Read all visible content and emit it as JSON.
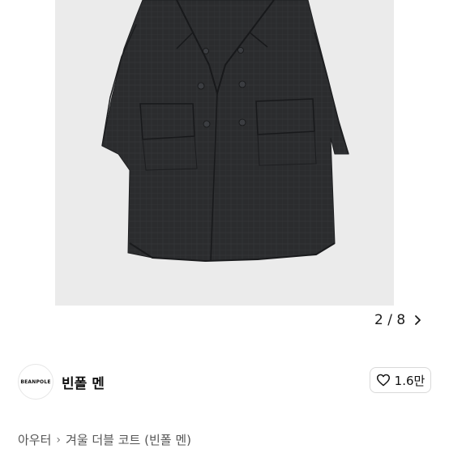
{
  "gallery": {
    "current_page": "2",
    "separator": "/",
    "total_pages": "8",
    "image_alt": "double-breasted dark check wool coat"
  },
  "shop": {
    "logo_text": "BEANPOLE",
    "name": "빈폴 멘",
    "like_count": "1.6만"
  },
  "breadcrumb": {
    "category": "아우터",
    "title": "겨울 더블 코트 (빈폴 멘)"
  },
  "colors": {
    "photo_bg": "#ebebeb",
    "coat": "#2b2c2e",
    "border": "#d9d9d9"
  }
}
